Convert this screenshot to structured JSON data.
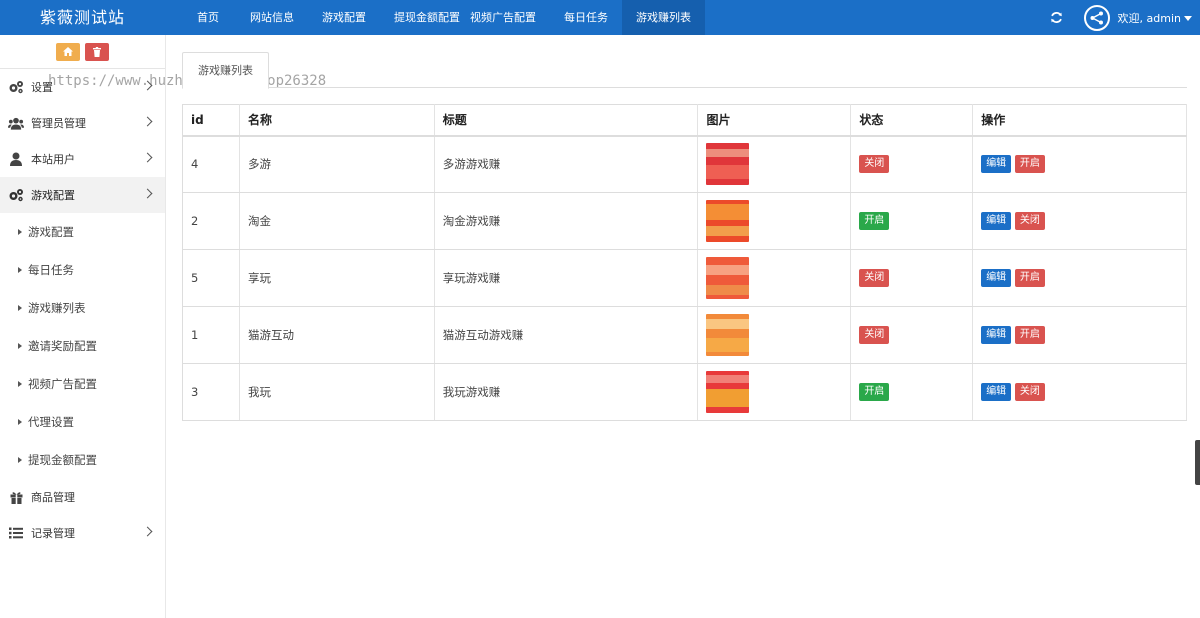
{
  "app": {
    "title": "紫薇测试站"
  },
  "nav": {
    "items": [
      {
        "label": "首页",
        "active": false
      },
      {
        "label": "网站信息",
        "active": false
      },
      {
        "label": "游戏配置",
        "active": false
      },
      {
        "label": "提现金额配置",
        "active": false
      },
      {
        "label": "视频广告配置",
        "active": false
      },
      {
        "label": "每日任务",
        "active": false
      },
      {
        "label": "游戏赚列表",
        "active": true
      }
    ]
  },
  "user": {
    "welcome": "欢迎, admin"
  },
  "sidebar": {
    "items": [
      {
        "label": "设置",
        "icon": "gears-icon",
        "has_children": true
      },
      {
        "label": "管理员管理",
        "icon": "users-icon",
        "has_children": true
      },
      {
        "label": "本站用户",
        "icon": "user-icon",
        "has_children": true
      },
      {
        "label": "游戏配置",
        "icon": "gears-icon",
        "has_children": true,
        "active": true
      }
    ],
    "sub_items": [
      {
        "label": "游戏配置"
      },
      {
        "label": "每日任务"
      },
      {
        "label": "游戏赚列表"
      },
      {
        "label": "邀请奖励配置"
      },
      {
        "label": "视频广告配置"
      },
      {
        "label": "代理设置"
      },
      {
        "label": "提现金额配置"
      }
    ],
    "bottom_items": [
      {
        "label": "商品管理",
        "icon": "gift-icon",
        "has_children": false
      },
      {
        "label": "记录管理",
        "icon": "list-icon",
        "has_children": true
      }
    ]
  },
  "watermark": "https://www.huzhan.com/ishop26328",
  "tab": {
    "label": "游戏赚列表"
  },
  "table": {
    "columns": [
      "id",
      "名称",
      "标题",
      "图片",
      "状态",
      "操作"
    ],
    "rows": [
      {
        "id": "4",
        "name": "多游",
        "title": "多游游戏赚",
        "status": "关闭",
        "status_color": "#d9534f",
        "edit": "编辑",
        "toggle": "开启"
      },
      {
        "id": "2",
        "name": "淘金",
        "title": "淘金游戏赚",
        "status": "开启",
        "status_color": "#2aa84a",
        "edit": "编辑",
        "toggle": "关闭"
      },
      {
        "id": "5",
        "name": "享玩",
        "title": "享玩游戏赚",
        "status": "关闭",
        "status_color": "#d9534f",
        "edit": "编辑",
        "toggle": "开启"
      },
      {
        "id": "1",
        "name": "猫游互动",
        "title": "猫游互动游戏赚",
        "status": "关闭",
        "status_color": "#d9534f",
        "edit": "编辑",
        "toggle": "开启"
      },
      {
        "id": "3",
        "name": "我玩",
        "title": "我玩游戏赚",
        "status": "开启",
        "status_color": "#2aa84a",
        "edit": "编辑",
        "toggle": "关闭"
      }
    ]
  },
  "colors": {
    "primary": "#1b6fc7",
    "danger": "#d9534f",
    "success": "#2aa84a",
    "warning": "#f0ad4e"
  }
}
